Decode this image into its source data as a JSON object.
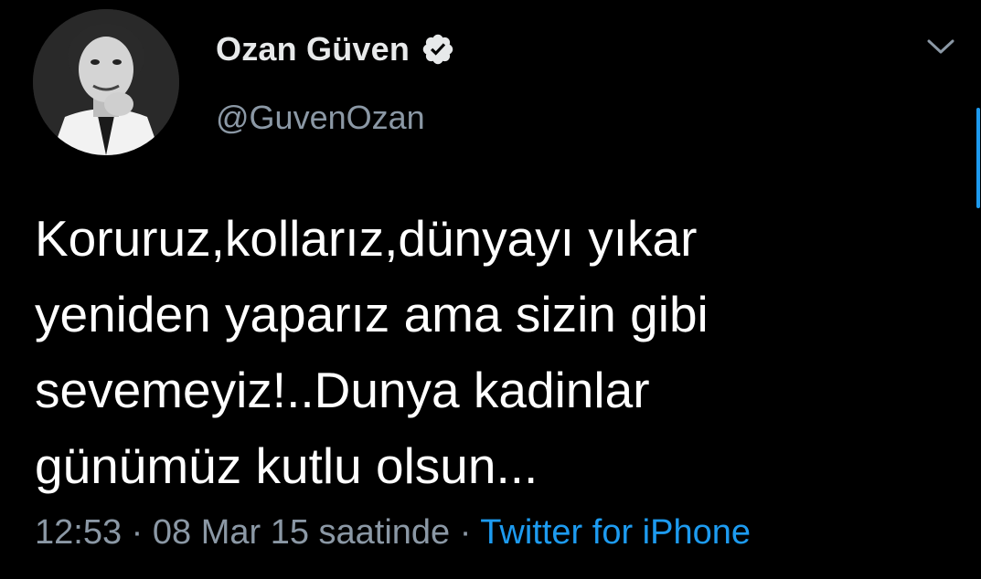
{
  "tweet": {
    "author": {
      "display_name": "Ozan Güven",
      "handle": "@GuvenOzan",
      "verified": true,
      "avatar_icon": "profile-photo"
    },
    "text": "Koruruz,kollarız,dünyayı yıkar\nyeniden yaparız ama sizin gibi\nsevemeyiz!..Dunya kadinlar\ngünümüz kutlu olsun...",
    "time": "12:53",
    "date": "08 Mar 15 saatinde",
    "separator": "·",
    "source": "Twitter for iPhone"
  },
  "colors": {
    "background": "#000000",
    "text_primary": "#ffffff",
    "text_secondary": "#8b98a5",
    "link": "#1d9bf0"
  },
  "icons": {
    "verified": "verified-badge-icon",
    "menu": "chevron-down-icon"
  }
}
